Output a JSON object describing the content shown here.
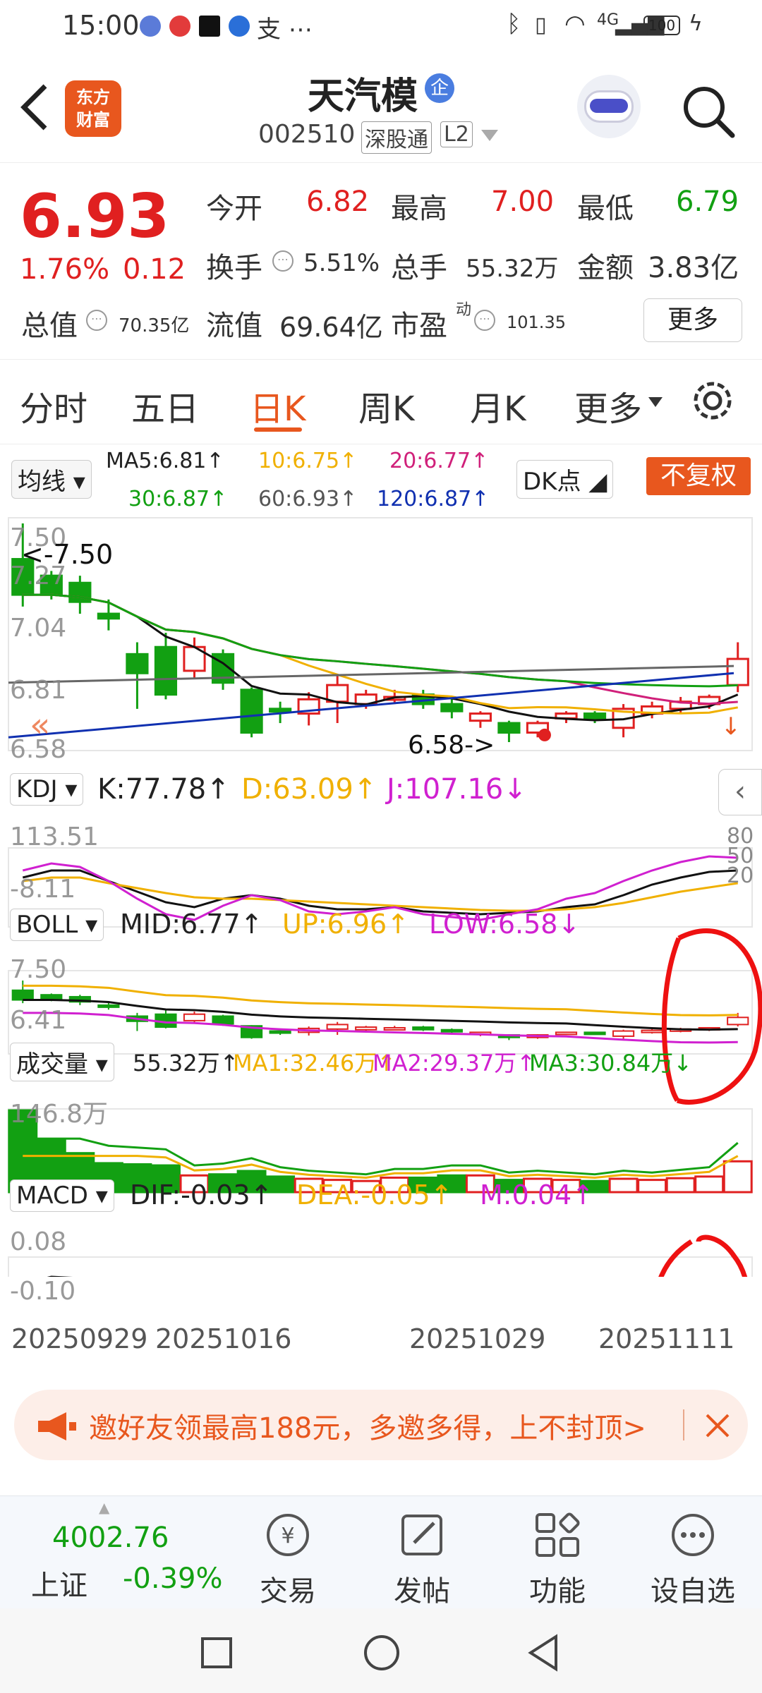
{
  "status": {
    "time": "15:00",
    "battery": "100",
    "network": "4G"
  },
  "header": {
    "title": "天汽模",
    "badge": "企",
    "code": "002510",
    "market": "深股通",
    "level": "L2",
    "logo_line1": "东方",
    "logo_line2": "财富"
  },
  "quote": {
    "price": "6.93",
    "change_pct": "1.76%",
    "change": "0.12",
    "open_label": "今开",
    "open": "6.82",
    "high_label": "最高",
    "high": "7.00",
    "low_label": "最低",
    "low": "6.79",
    "turnover_label": "换手",
    "turnover": "5.51%",
    "volume_label": "总手",
    "volume": "55.32万",
    "amount_label": "金额",
    "amount": "3.83亿",
    "mktcap_label": "总值",
    "mktcap": "70.35亿",
    "float_label": "流值",
    "float": "69.64亿",
    "pe_label": "市盈",
    "pe_sup": "动",
    "pe": "101.35",
    "more": "更多"
  },
  "tabs": [
    "分时",
    "五日",
    "日K",
    "周K",
    "月K",
    "更多"
  ],
  "active_tab": "日K",
  "ma": {
    "selector": "均线",
    "ma5": "MA5:6.81↑",
    "ma10": "10:6.75↑",
    "ma20": "20:6.77↑",
    "ma30": "30:6.87↑",
    "ma60": "60:6.93↑",
    "ma120": "120:6.87↑",
    "dk": "DK点",
    "fq": "不复权",
    "y_top": "7.50",
    "y_2": "7.27",
    "y_3": "7.04",
    "y_4": "6.81",
    "y_5": "6.58",
    "high_mark": "<-7.50",
    "low_mark": "6.58->"
  },
  "kdj": {
    "selector": "KDJ",
    "k": "K:77.78↑",
    "d": "D:63.09↑",
    "j": "J:107.16↓",
    "y_top": "113.51",
    "y_bot": "-8.11",
    "r1": "80",
    "r2": "50",
    "r3": "20"
  },
  "boll": {
    "selector": "BOLL",
    "mid": "MID:6.77↑",
    "up": "UP:6.96↑",
    "low": "LOW:6.58↓",
    "y_top": "7.50",
    "y_bot": "6.41"
  },
  "vol": {
    "selector": "成交量",
    "v": "55.32万↑",
    "ma1": "MA1:32.46万↑",
    "ma2": "MA2:29.37万↑",
    "ma3": "MA3:30.84万↓",
    "y_top": "146.8万"
  },
  "macd": {
    "selector": "MACD",
    "dif": "DIF:-0.03↑",
    "dea": "DEA:-0.05↑",
    "m": "M:0.04↑",
    "y_top": "0.08",
    "y_bot": "-0.10"
  },
  "dates": [
    "20250929",
    "20251016",
    "20251029",
    "20251111"
  ],
  "banner": {
    "text": "邀好友领最高188元，多邀多得，上不封顶>"
  },
  "bottom": {
    "index_value": "4002.76",
    "index_name": "上证",
    "index_change": "-0.39%",
    "items": [
      "交易",
      "发帖",
      "功能",
      "设自选"
    ]
  },
  "chart_data": {
    "type": "candlestick",
    "candles": [
      {
        "o": 7.35,
        "c": 7.2,
        "h": 7.5,
        "l": 7.15
      },
      {
        "o": 7.28,
        "c": 7.2,
        "h": 7.3,
        "l": 7.18
      },
      {
        "o": 7.25,
        "c": 7.17,
        "h": 7.28,
        "l": 7.12
      },
      {
        "o": 7.12,
        "c": 7.1,
        "h": 7.18,
        "l": 7.05
      },
      {
        "o": 6.95,
        "c": 6.87,
        "h": 7.0,
        "l": 6.72
      },
      {
        "o": 6.98,
        "c": 6.78,
        "h": 7.04,
        "l": 6.76
      },
      {
        "o": 6.88,
        "c": 6.98,
        "h": 7.02,
        "l": 6.85
      },
      {
        "o": 6.95,
        "c": 6.83,
        "h": 6.97,
        "l": 6.8
      },
      {
        "o": 6.8,
        "c": 6.62,
        "h": 6.81,
        "l": 6.6
      },
      {
        "o": 6.72,
        "c": 6.71,
        "h": 6.75,
        "l": 6.66
      },
      {
        "o": 6.7,
        "c": 6.76,
        "h": 6.79,
        "l": 6.65
      },
      {
        "o": 6.75,
        "c": 6.82,
        "h": 6.86,
        "l": 6.66
      },
      {
        "o": 6.74,
        "c": 6.78,
        "h": 6.8,
        "l": 6.72
      },
      {
        "o": 6.77,
        "c": 6.77,
        "h": 6.8,
        "l": 6.74
      },
      {
        "o": 6.78,
        "c": 6.74,
        "h": 6.8,
        "l": 6.72
      },
      {
        "o": 6.74,
        "c": 6.71,
        "h": 6.76,
        "l": 6.68
      },
      {
        "o": 6.67,
        "c": 6.7,
        "h": 6.71,
        "l": 6.64
      },
      {
        "o": 6.66,
        "c": 6.62,
        "h": 6.67,
        "l": 6.58
      },
      {
        "o": 6.62,
        "c": 6.66,
        "h": 6.67,
        "l": 6.6
      },
      {
        "o": 6.68,
        "c": 6.7,
        "h": 6.71,
        "l": 6.66
      },
      {
        "o": 6.7,
        "c": 6.68,
        "h": 6.71,
        "l": 6.66
      },
      {
        "o": 6.64,
        "c": 6.72,
        "h": 6.74,
        "l": 6.6
      },
      {
        "o": 6.7,
        "c": 6.73,
        "h": 6.75,
        "l": 6.68
      },
      {
        "o": 6.72,
        "c": 6.75,
        "h": 6.77,
        "l": 6.7
      },
      {
        "o": 6.74,
        "c": 6.77,
        "h": 6.78,
        "l": 6.72
      },
      {
        "o": 6.82,
        "c": 6.93,
        "h": 7.0,
        "l": 6.79
      }
    ],
    "volumes": [
      146.8,
      95,
      70,
      52,
      50,
      48,
      30,
      32,
      38,
      28,
      24,
      22,
      20,
      26,
      26,
      30,
      30,
      22,
      24,
      22,
      20,
      24,
      22,
      25,
      28,
      55.32
    ],
    "ylim": [
      6.58,
      7.5
    ],
    "x": [
      "20250929",
      "20251016",
      "20251029",
      "20251111"
    ]
  }
}
